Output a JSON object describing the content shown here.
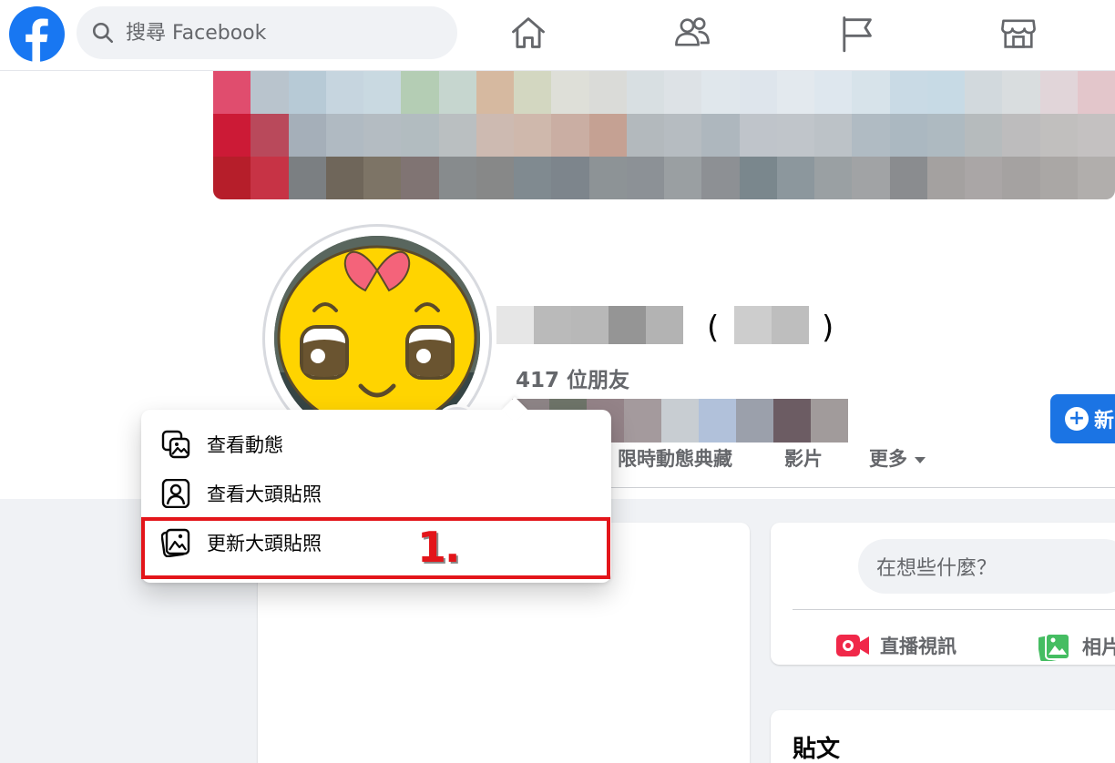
{
  "search": {
    "placeholder": "搜尋 Facebook"
  },
  "nav": {
    "icons": [
      "home-icon",
      "friends-icon",
      "pages-flag-icon",
      "marketplace-icon"
    ]
  },
  "profile": {
    "friends_count": "417 位朋友",
    "paren_open": "(",
    "paren_close": ")",
    "new_button_label": "新"
  },
  "tabs": {
    "stories_archive": "限時動態典藏",
    "videos": "影片",
    "more": "更多"
  },
  "menu": {
    "items": [
      {
        "label": "查看動態",
        "icon": "view-story-icon"
      },
      {
        "label": "查看大頭貼照",
        "icon": "profile-picture-icon"
      },
      {
        "label": "更新大頭貼照",
        "icon": "update-photo-icon"
      }
    ]
  },
  "annotation": {
    "step": "1."
  },
  "composer": {
    "placeholder": "在想些什麼？",
    "live_video": "直播視訊",
    "photo": "相片"
  },
  "posts": {
    "title": "貼文"
  },
  "colors": {
    "facebook_blue": "#1877f2",
    "button_blue": "#1b74e4",
    "annotation_red": "#e3151a"
  }
}
